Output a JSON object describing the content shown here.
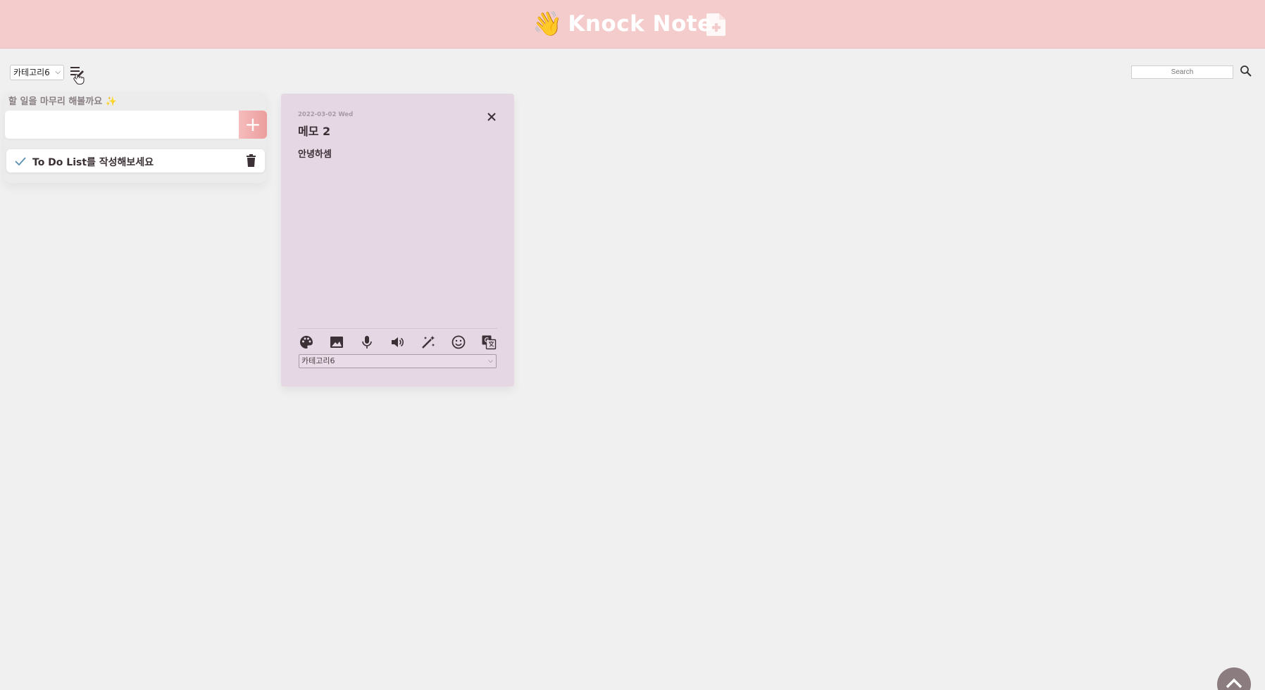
{
  "header": {
    "emoji": "👋",
    "title": "Knock Note"
  },
  "toolbar": {
    "category_selected": "카테고리6",
    "search_placeholder": "Search"
  },
  "todo": {
    "prompt": "할 일을 마무리 해볼까요 ✨",
    "add_label": "+",
    "items": [
      {
        "text": "To Do List를 작성해보세요"
      }
    ]
  },
  "memo": {
    "date": "2022-03-02 Wed",
    "title": "메모 2",
    "body": "안녕하셈",
    "category_selected": "카테고리6",
    "background": "#e6d7e4"
  },
  "colors": {
    "header": "#f4cccc",
    "accent": "#ec9d9d",
    "page": "#f0f0f0"
  }
}
